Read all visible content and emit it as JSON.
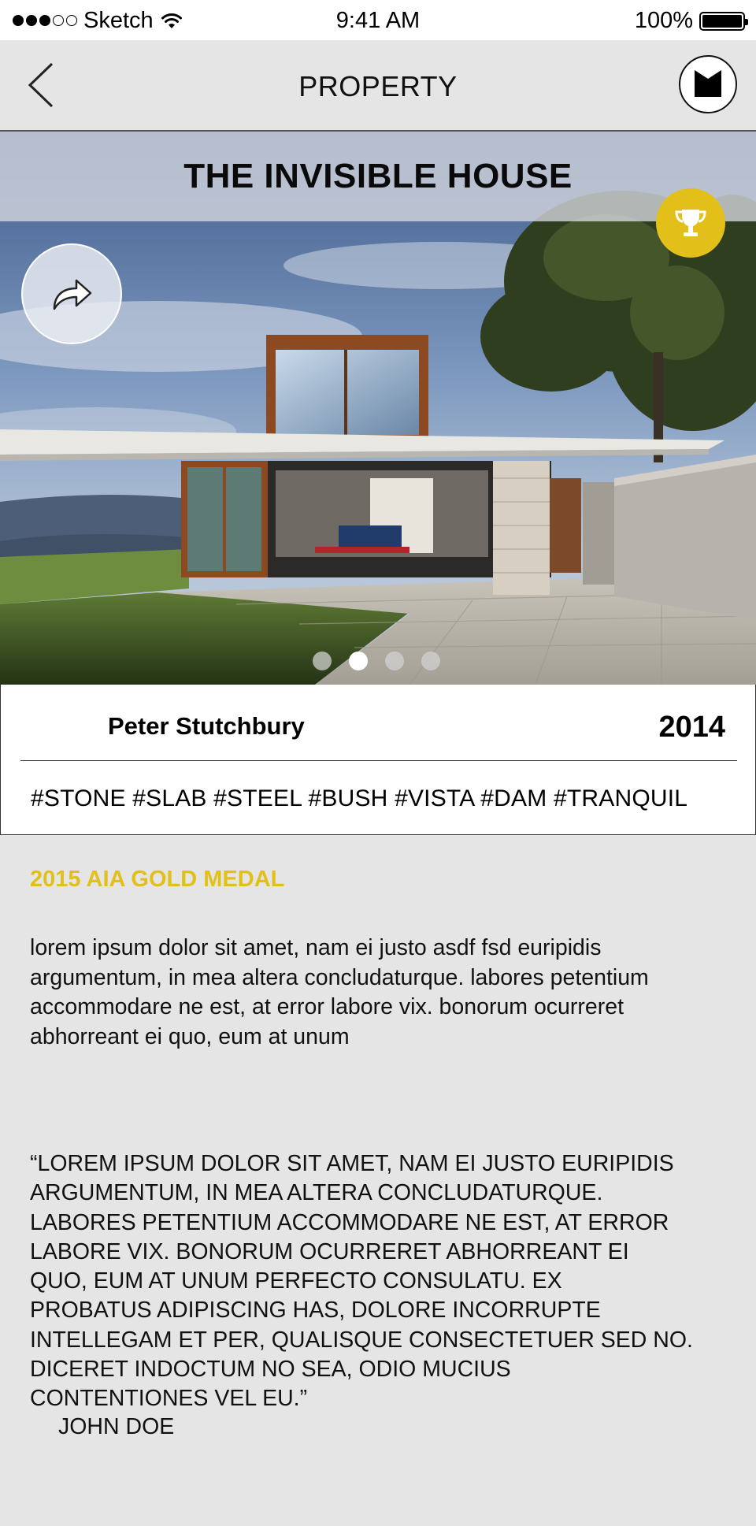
{
  "status_bar": {
    "carrier": "Sketch",
    "time": "9:41 AM",
    "battery": "100%"
  },
  "nav": {
    "title": "PROPERTY",
    "back_icon": "chevron-left-icon",
    "brand_icon": "m-logo-icon"
  },
  "hero": {
    "title": "THE INVISIBLE HOUSE",
    "award_icon": "trophy-icon",
    "share_icon": "share-arrow-icon",
    "pager_count": 4,
    "pager_active": 1
  },
  "info": {
    "architect": "Peter Stutchbury",
    "year": "2014",
    "tags": "#STONE #SLAB #STEEL #BUSH #VISTA #DAM #TRANQUIL"
  },
  "award": {
    "label": "2015 AIA GOLD MEDAL"
  },
  "description": "lorem ipsum dolor sit amet, nam ei justo asdf fsd euripidis argumentum, in mea altera concludaturque. labores petentium accommodare ne est, at error labore vix. bonorum ocurreret abhorreant ei quo, eum at unum",
  "quote": {
    "lines": [
      "“LOREM IPSUM DOLOR SIT AMET, NAM EI JUSTO EURIPIDIS",
      "ARGUMENTUM, IN MEA ALTERA CONCLUDATURQUE.",
      "LABORES PETENTIUM ACCOMMODARE NE EST, AT ERROR",
      "LABORE VIX. BONORUM OCURRERET ABHORREANT EI",
      "QUO, EUM AT UNUM PERFECTO CONSULATU. EX",
      "PROBATUS ADIPISCING HAS, DOLORE INCORRUPTE",
      "INTELLEGAM ET PER, QUALISQUE CONSECTETUER SED NO.",
      "DICERET INDOCTUM NO SEA, ODIO MUCIUS",
      "CONTENTIONES VEL EU.”"
    ],
    "author": "JOHN DOE"
  },
  "colors": {
    "accent": "#e3bf1a",
    "background": "#e5e5e5"
  }
}
